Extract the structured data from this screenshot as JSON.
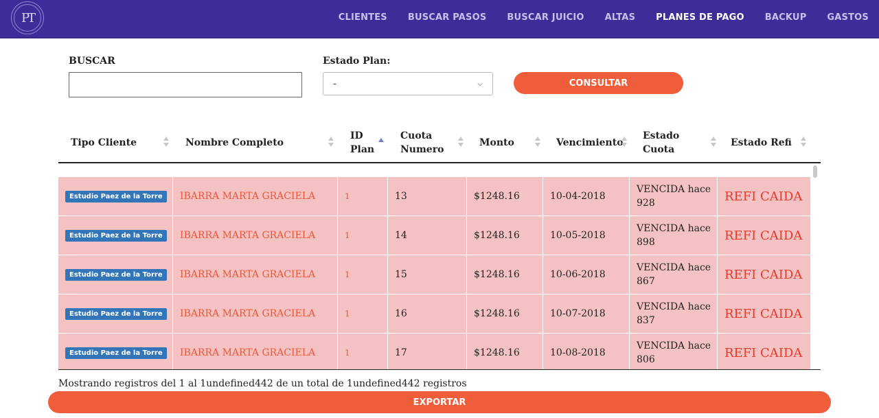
{
  "nav": {
    "logo_text": "PT",
    "items": [
      "CLIENTES",
      "BUSCAR PASOS",
      "BUSCAR JUICIO",
      "ALTAS",
      "PLANES DE PAGO",
      "BACKUP",
      "GASTOS"
    ],
    "active": "PLANES DE PAGO"
  },
  "filters": {
    "search_label": "BUSCAR",
    "search_value": "",
    "estado_label": "Estado Plan:",
    "estado_selected": "-",
    "consultar_label": "CONSULTAR"
  },
  "table": {
    "headers": {
      "tipo": "Tipo Cliente",
      "nombre": "Nombre Completo",
      "idplan": "ID Plan",
      "cuota": "Cuota Numero",
      "monto": "Monto",
      "venc": "Vencimiento",
      "estcuota": "Estado Cuota",
      "estrefi": "Estado Refi"
    },
    "rows": [
      {
        "tipo": "Estudio Paez de la Torre",
        "nombre": "IBARRA MARTA GRACIELA",
        "idplan": "1",
        "cuota": "13",
        "monto": "$1248.16",
        "venc": "10-04-2018",
        "estcuota": "VENCIDA hace 928",
        "estrefi": "REFI CAIDA"
      },
      {
        "tipo": "Estudio Paez de la Torre",
        "nombre": "IBARRA MARTA GRACIELA",
        "idplan": "1",
        "cuota": "14",
        "monto": "$1248.16",
        "venc": "10-05-2018",
        "estcuota": "VENCIDA hace 898",
        "estrefi": "REFI CAIDA"
      },
      {
        "tipo": "Estudio Paez de la Torre",
        "nombre": "IBARRA MARTA GRACIELA",
        "idplan": "1",
        "cuota": "15",
        "monto": "$1248.16",
        "venc": "10-06-2018",
        "estcuota": "VENCIDA hace 867",
        "estrefi": "REFI CAIDA"
      },
      {
        "tipo": "Estudio Paez de la Torre",
        "nombre": "IBARRA MARTA GRACIELA",
        "idplan": "1",
        "cuota": "16",
        "monto": "$1248.16",
        "venc": "10-07-2018",
        "estcuota": "VENCIDA hace 837",
        "estrefi": "REFI CAIDA"
      },
      {
        "tipo": "Estudio Paez de la Torre",
        "nombre": "IBARRA MARTA GRACIELA",
        "idplan": "1",
        "cuota": "17",
        "monto": "$1248.16",
        "venc": "10-08-2018",
        "estcuota": "VENCIDA hace 806",
        "estrefi": "REFI CAIDA"
      }
    ]
  },
  "footer": {
    "info": "Mostrando registros del 1 al 1undefined442 de un total de 1undefined442 registros",
    "export_label": "EXPORTAR"
  },
  "colors": {
    "navbar": "#3e2d99",
    "accent": "#f05d3b",
    "row_bg": "#f5c2c3",
    "badge": "#3276b9"
  }
}
